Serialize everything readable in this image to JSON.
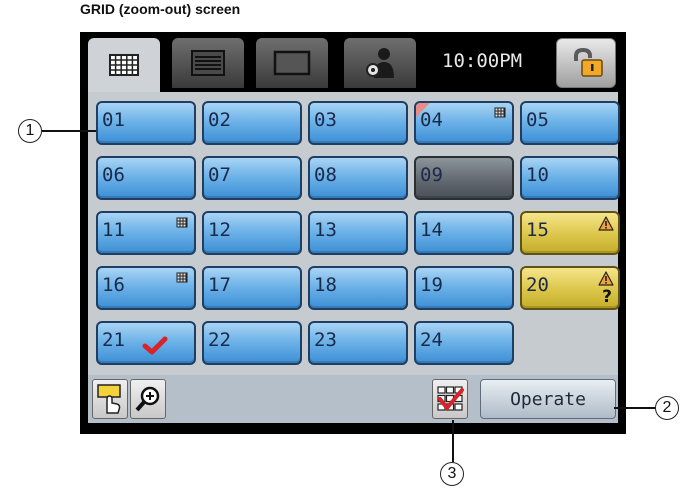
{
  "heading": "GRID (zoom-out) screen",
  "tabs": [
    {
      "icon": "grid-icon",
      "active": true
    },
    {
      "icon": "list-icon",
      "active": false
    },
    {
      "icon": "single-view-icon",
      "active": false
    },
    {
      "icon": "user-settings-icon",
      "active": false
    }
  ],
  "clock": "10:00PM",
  "lock": {
    "icon": "padlock-icon"
  },
  "cells": [
    {
      "label": "01",
      "state": "normal"
    },
    {
      "label": "02",
      "state": "normal"
    },
    {
      "label": "03",
      "state": "normal"
    },
    {
      "label": "04",
      "state": "normal",
      "icons": [
        "corner-flag-icon",
        "grid-mini-icon"
      ]
    },
    {
      "label": "05",
      "state": "normal"
    },
    {
      "label": "06",
      "state": "normal"
    },
    {
      "label": "07",
      "state": "normal"
    },
    {
      "label": "08",
      "state": "normal"
    },
    {
      "label": "09",
      "state": "inactive"
    },
    {
      "label": "10",
      "state": "normal"
    },
    {
      "label": "11",
      "state": "normal",
      "icons": [
        "grid-mini-icon"
      ]
    },
    {
      "label": "12",
      "state": "normal"
    },
    {
      "label": "13",
      "state": "normal"
    },
    {
      "label": "14",
      "state": "normal"
    },
    {
      "label": "15",
      "state": "warning",
      "icons": [
        "warning-icon"
      ]
    },
    {
      "label": "16",
      "state": "normal",
      "icons": [
        "grid-mini-icon"
      ]
    },
    {
      "label": "17",
      "state": "normal"
    },
    {
      "label": "18",
      "state": "normal"
    },
    {
      "label": "19",
      "state": "normal"
    },
    {
      "label": "20",
      "state": "warning",
      "icons": [
        "warning-icon",
        "question-icon"
      ]
    },
    {
      "label": "21",
      "state": "normal",
      "icons": [
        "checkmark-icon"
      ]
    },
    {
      "label": "22",
      "state": "normal"
    },
    {
      "label": "23",
      "state": "normal"
    },
    {
      "label": "24",
      "state": "normal"
    }
  ],
  "question_mark": "?",
  "bottom": {
    "tool_buttons": [
      "touch-select-icon",
      "zoom-icon",
      "multi-check-icon"
    ],
    "operate_label": "Operate"
  },
  "callouts": [
    "1",
    "2",
    "3"
  ],
  "colors": {
    "cell_blue": "#6eb3e8",
    "cell_warning": "#dbc64a",
    "cell_inactive": "#5f666d",
    "check_red": "#d9222a",
    "panel_bg": "#c6cbd0"
  }
}
